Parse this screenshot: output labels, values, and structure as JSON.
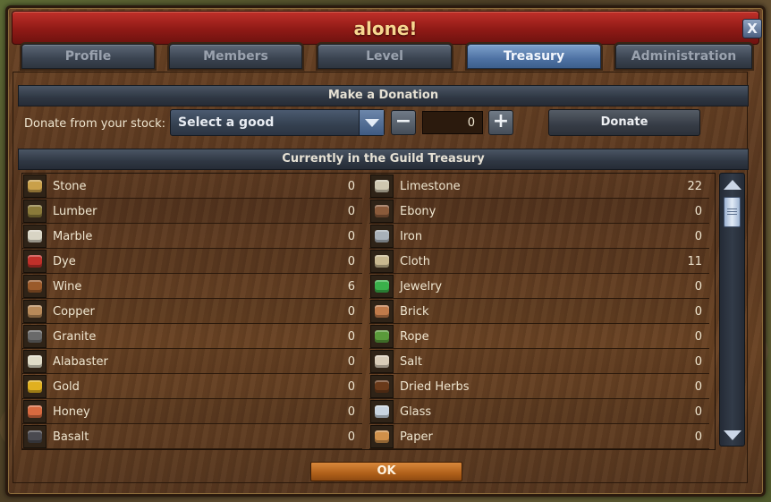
{
  "window": {
    "title": "alone!",
    "close_label": "X"
  },
  "tabs": [
    {
      "label": "Profile",
      "active": false
    },
    {
      "label": "Members",
      "active": false
    },
    {
      "label": "Level",
      "active": false
    },
    {
      "label": "Treasury",
      "active": true
    },
    {
      "label": "Administration",
      "active": false
    }
  ],
  "donation": {
    "header": "Make a Donation",
    "label": "Donate from your stock:",
    "select_value": "Select a good",
    "minus_label": "−",
    "plus_label": "+",
    "quantity": "0",
    "donate_label": "Donate"
  },
  "treasury": {
    "header": "Currently in the Guild Treasury",
    "left": [
      {
        "name": "Stone",
        "value": "0",
        "icon": "stone-icon",
        "color": "#c9a04a"
      },
      {
        "name": "Lumber",
        "value": "0",
        "icon": "lumber-icon",
        "color": "#8a7a3a"
      },
      {
        "name": "Marble",
        "value": "0",
        "icon": "marble-icon",
        "color": "#d8d4c4"
      },
      {
        "name": "Dye",
        "value": "0",
        "icon": "dye-icon",
        "color": "#c0302a"
      },
      {
        "name": "Wine",
        "value": "6",
        "icon": "wine-icon",
        "color": "#9a5a2a"
      },
      {
        "name": "Copper",
        "value": "0",
        "icon": "copper-icon",
        "color": "#b88a5a"
      },
      {
        "name": "Granite",
        "value": "0",
        "icon": "granite-icon",
        "color": "#6a6a6a"
      },
      {
        "name": "Alabaster",
        "value": "0",
        "icon": "alabaster-icon",
        "color": "#e0dcc8"
      },
      {
        "name": "Gold",
        "value": "0",
        "icon": "gold-icon",
        "color": "#e0b020"
      },
      {
        "name": "Honey",
        "value": "0",
        "icon": "honey-icon",
        "color": "#d86a40"
      },
      {
        "name": "Basalt",
        "value": "0",
        "icon": "basalt-icon",
        "color": "#4a4a50"
      }
    ],
    "right": [
      {
        "name": "Limestone",
        "value": "22",
        "icon": "limestone-icon",
        "color": "#cfc7b0"
      },
      {
        "name": "Ebony",
        "value": "0",
        "icon": "ebony-icon",
        "color": "#8a5a3a"
      },
      {
        "name": "Iron",
        "value": "0",
        "icon": "iron-icon",
        "color": "#a8b0b8"
      },
      {
        "name": "Cloth",
        "value": "11",
        "icon": "cloth-icon",
        "color": "#c8b890"
      },
      {
        "name": "Jewelry",
        "value": "0",
        "icon": "jewelry-icon",
        "color": "#3ab04a"
      },
      {
        "name": "Brick",
        "value": "0",
        "icon": "brick-icon",
        "color": "#c07a4a"
      },
      {
        "name": "Rope",
        "value": "0",
        "icon": "rope-icon",
        "color": "#5a9a3a"
      },
      {
        "name": "Salt",
        "value": "0",
        "icon": "salt-icon",
        "color": "#d8ccb8"
      },
      {
        "name": "Dried Herbs",
        "value": "0",
        "icon": "dried-herbs-icon",
        "color": "#6a3a1a"
      },
      {
        "name": "Glass",
        "value": "0",
        "icon": "glass-icon",
        "color": "#c8d4e0"
      },
      {
        "name": "Paper",
        "value": "0",
        "icon": "paper-icon",
        "color": "#d0904a"
      }
    ]
  },
  "footer": {
    "ok_label": "OK"
  }
}
